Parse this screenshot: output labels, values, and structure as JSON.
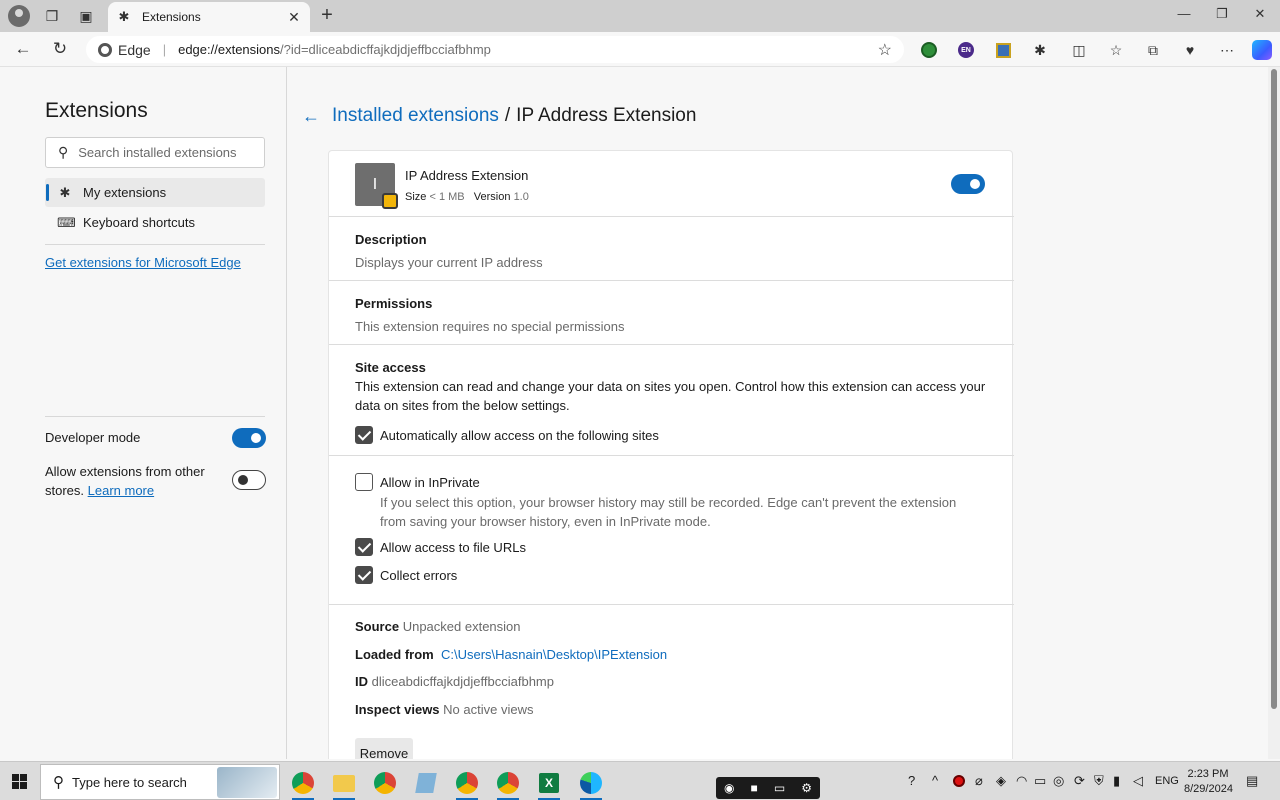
{
  "browser": {
    "tab_title": "Extensions",
    "address": {
      "scheme_label": "Edge",
      "url_host": "edge://extensions",
      "url_rest": "/?id=dliceabdicffajkdjdjeffbcciafbhmp"
    }
  },
  "sidebar": {
    "title": "Extensions",
    "search_placeholder": "Search installed extensions",
    "items": [
      {
        "label": "My extensions",
        "icon": "puzzle-icon"
      },
      {
        "label": "Keyboard shortcuts",
        "icon": "keyboard-icon"
      }
    ],
    "store_link": "Get extensions for Microsoft Edge",
    "developer_mode_label": "Developer mode",
    "developer_mode_on": true,
    "allow_other_stores_label": "Allow extensions from other stores.",
    "learn_more": "Learn more",
    "allow_other_stores_on": false
  },
  "breadcrumb": {
    "parent": "Installed extensions",
    "separator": "/",
    "current": "IP Address Extension"
  },
  "extension": {
    "tile_letter": "I",
    "name": "IP Address Extension",
    "size_label": "Size",
    "size_value": "< 1 MB",
    "version_label": "Version",
    "version_value": "1.0",
    "enabled": true,
    "description_title": "Description",
    "description": "Displays your current IP address",
    "permissions_title": "Permissions",
    "permissions": "This extension requires no special permissions",
    "site_access_title": "Site access",
    "site_access_text": "This extension can read and change your data on sites you open. Control how this extension can access your data on sites from the below settings.",
    "auto_allow_label": "Automatically allow access on the following sites",
    "auto_allow_checked": true,
    "inprivate_label": "Allow in InPrivate",
    "inprivate_checked": false,
    "inprivate_help": "If you select this option, your browser history may still be recorded. Edge can't prevent the extension from saving your browser history, even in InPrivate mode.",
    "file_urls_label": "Allow access to file URLs",
    "file_urls_checked": true,
    "collect_errors_label": "Collect errors",
    "collect_errors_checked": true,
    "source_label": "Source",
    "source_value": "Unpacked extension",
    "loaded_from_label": "Loaded from",
    "loaded_from_value": "C:\\Users\\Hasnain\\Desktop\\IPExtension",
    "id_label": "ID",
    "id_value": "dliceabdicffajkdjdjeffbcciafbhmp",
    "inspect_label": "Inspect views",
    "inspect_value": "No active views",
    "remove_button": "Remove"
  },
  "taskbar": {
    "search_text": "Type here to search",
    "language": "ENG",
    "time": "2:23 PM",
    "date": "8/29/2024"
  },
  "colors": {
    "accent": "#0f6cbd",
    "checkbox": "#4a4a4a"
  }
}
